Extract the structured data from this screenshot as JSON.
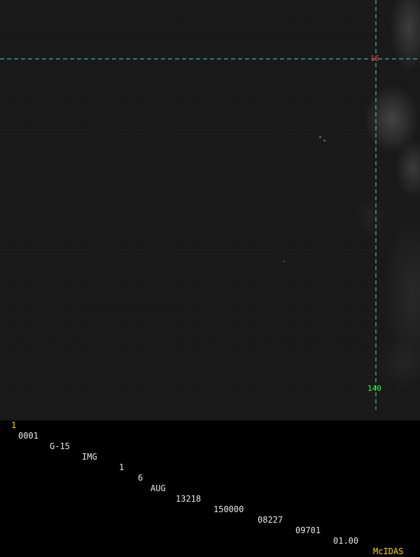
{
  "colors": {
    "grid_line": "#3fd6d6",
    "lat_label": "#ff3030",
    "lon_label": "#33ff33",
    "status_text": "#e8e8e8",
    "status_accent": "#ffd400"
  },
  "grid": {
    "latitude_label": "15",
    "longitude_label": "140"
  },
  "status": {
    "frame": "1",
    "area": "0001",
    "satellite": "G-15",
    "type": "IMG",
    "band": "1",
    "day": "6",
    "month": "AUG",
    "julian_date": "13218",
    "time": "150000",
    "line": "08227",
    "element": "09701",
    "resolution": "01.00",
    "brand": "McIDAS"
  }
}
